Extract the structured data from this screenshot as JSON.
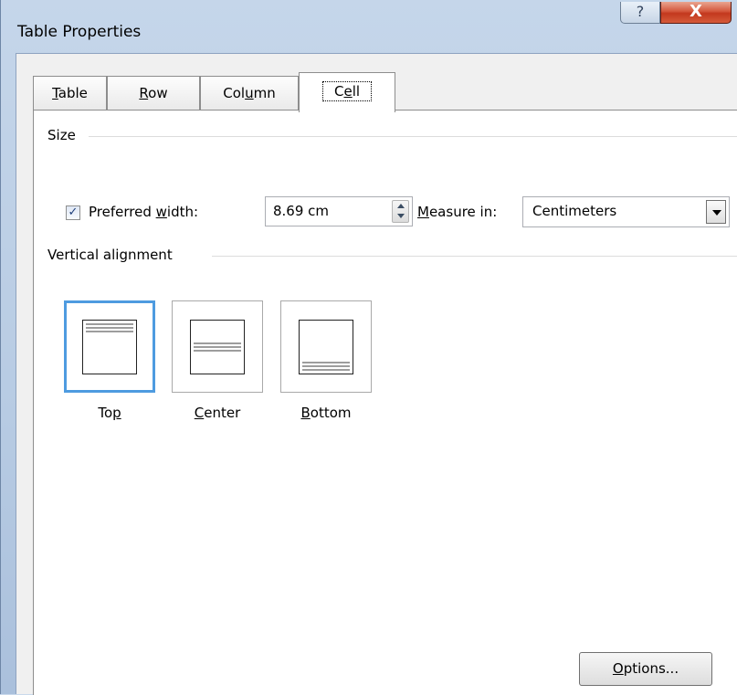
{
  "window": {
    "title": "Table Properties",
    "help_glyph": "?",
    "close_glyph": "X"
  },
  "tabs": [
    {
      "label": "Table",
      "mnemonic": "T"
    },
    {
      "label": "Row",
      "mnemonic": "R"
    },
    {
      "label": "Column",
      "mnemonic": "u"
    },
    {
      "label": "Cell",
      "mnemonic": "e",
      "active": true
    }
  ],
  "size_group": {
    "label": "Size",
    "preferred_width_checked": true,
    "preferred_width_label": "Preferred width:",
    "preferred_width_value": "8.69 cm",
    "measure_in_label": "Measure in:",
    "measure_in_value": "Centimeters"
  },
  "vertical_alignment_group": {
    "label": "Vertical alignment",
    "options": [
      {
        "label": "Top",
        "selected": true
      },
      {
        "label": "Center",
        "selected": false
      },
      {
        "label": "Bottom",
        "selected": false
      }
    ]
  },
  "buttons": {
    "options": "Options..."
  },
  "colors": {
    "selection_blue": "#4e9be0",
    "close_red": "#c2381e"
  }
}
